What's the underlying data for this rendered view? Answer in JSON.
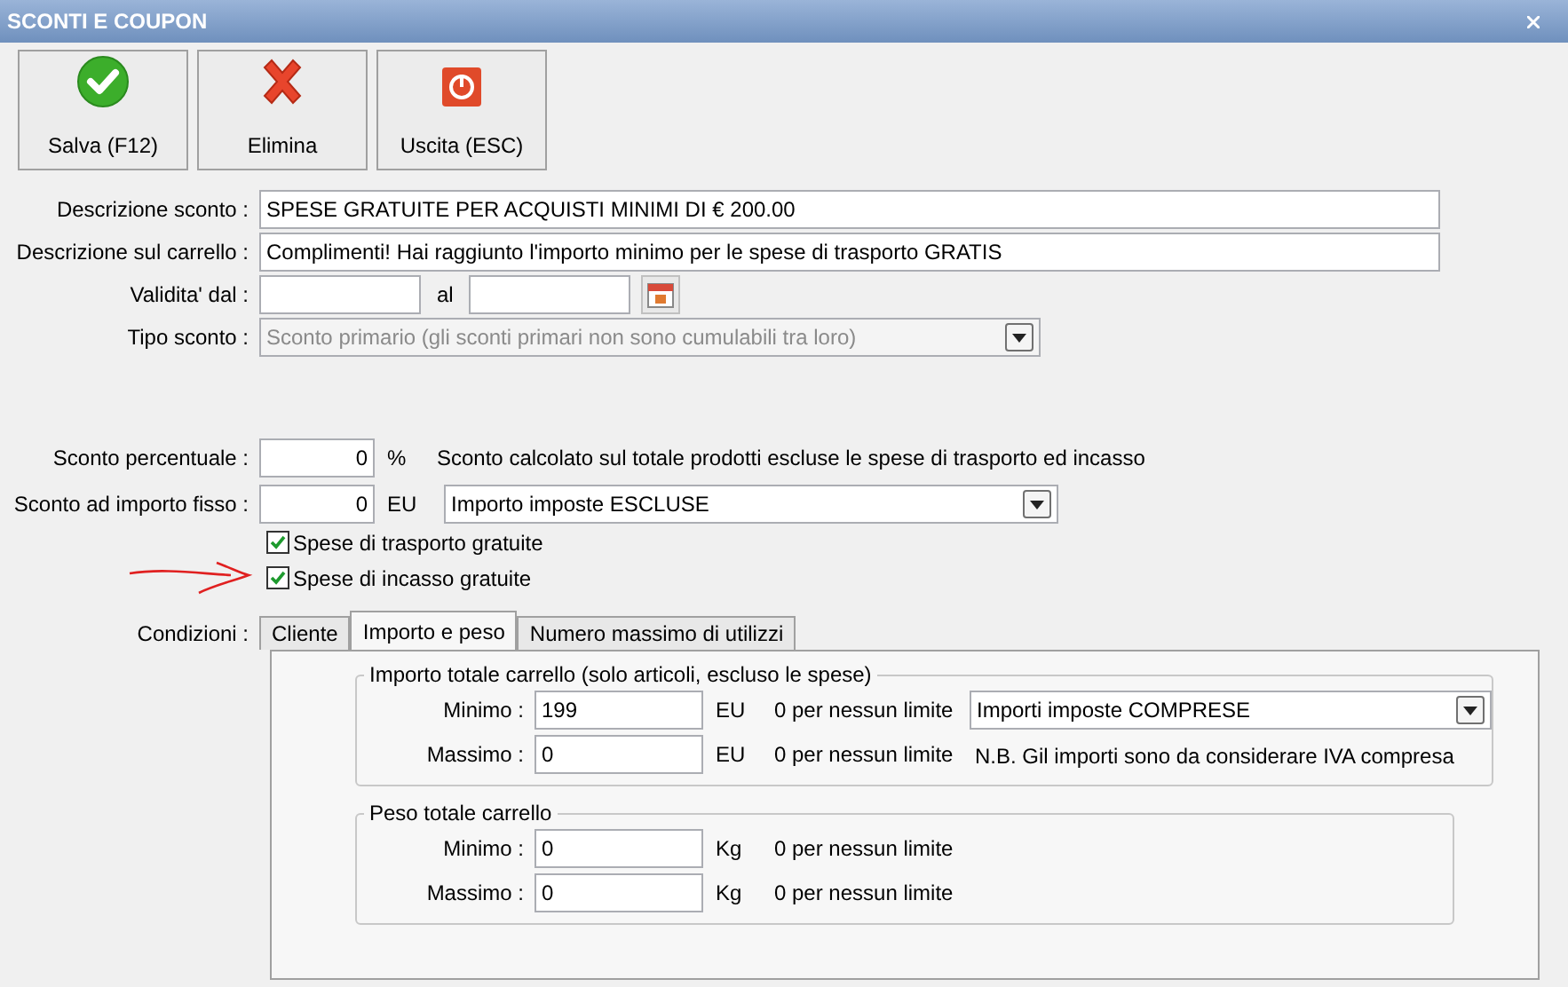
{
  "window": {
    "title": "SCONTI E COUPON"
  },
  "toolbar": [
    {
      "label": "Salva (F12)",
      "kind": "save"
    },
    {
      "label": "Elimina",
      "kind": "delete"
    },
    {
      "label": "Uscita (ESC)",
      "kind": "exit"
    }
  ],
  "description": {
    "label": "Descrizione sconto :",
    "value": "SPESE GRATUITE PER ACQUISTI MINIMI DI € 200.00"
  },
  "cart_description": {
    "label": "Descrizione sul carrello :",
    "value": "Complimenti! Hai raggiunto l'importo minimo per le spese di trasporto GRATIS"
  },
  "validity": {
    "label": "Validita' dal :",
    "to_label": "al"
  },
  "discount_type": {
    "label": "Tipo sconto :",
    "value": "Sconto primario (gli sconti primari non sono cumulabili tra loro)",
    "disabled": true
  },
  "percent": {
    "label": "Sconto percentuale :",
    "value": "0",
    "unit": "%",
    "note": "Sconto calcolato sul totale prodotti escluse le spese di trasporto ed incasso"
  },
  "fixed": {
    "label": "Sconto ad importo fisso :",
    "value": "0",
    "unit": "EU",
    "select": "Importo imposte ESCLUSE"
  },
  "checkboxes": [
    {
      "label": "Spese di trasporto gratuite",
      "checked": true
    },
    {
      "label": "Spese di incasso gratuite",
      "checked": true
    }
  ],
  "conditions": {
    "label": "Condizioni :",
    "tabs": [
      {
        "label": "Cliente",
        "selected": false
      },
      {
        "label": "Importo e peso",
        "selected": true
      },
      {
        "label": "Numero massimo di utilizzi",
        "selected": false
      }
    ],
    "groups": [
      {
        "title": "Importo totale carrello (solo articoli, escluso le spese)",
        "select": "Importi imposte COMPRESE",
        "note": "N.B. Gil importi sono da considerare IVA compresa",
        "rows": [
          {
            "label": "Minimo :",
            "value": "199",
            "unit": "EU",
            "hint": "0 per nessun limite"
          },
          {
            "label": "Massimo :",
            "value": "0",
            "unit": "EU",
            "hint": "0 per nessun limite"
          }
        ]
      },
      {
        "title": "Peso totale carrello",
        "rows": [
          {
            "label": "Minimo :",
            "value": "0",
            "unit": "Kg",
            "hint": "0 per nessun limite"
          },
          {
            "label": "Massimo :",
            "value": "0",
            "unit": "Kg",
            "hint": "0 per nessun limite"
          }
        ]
      }
    ]
  }
}
